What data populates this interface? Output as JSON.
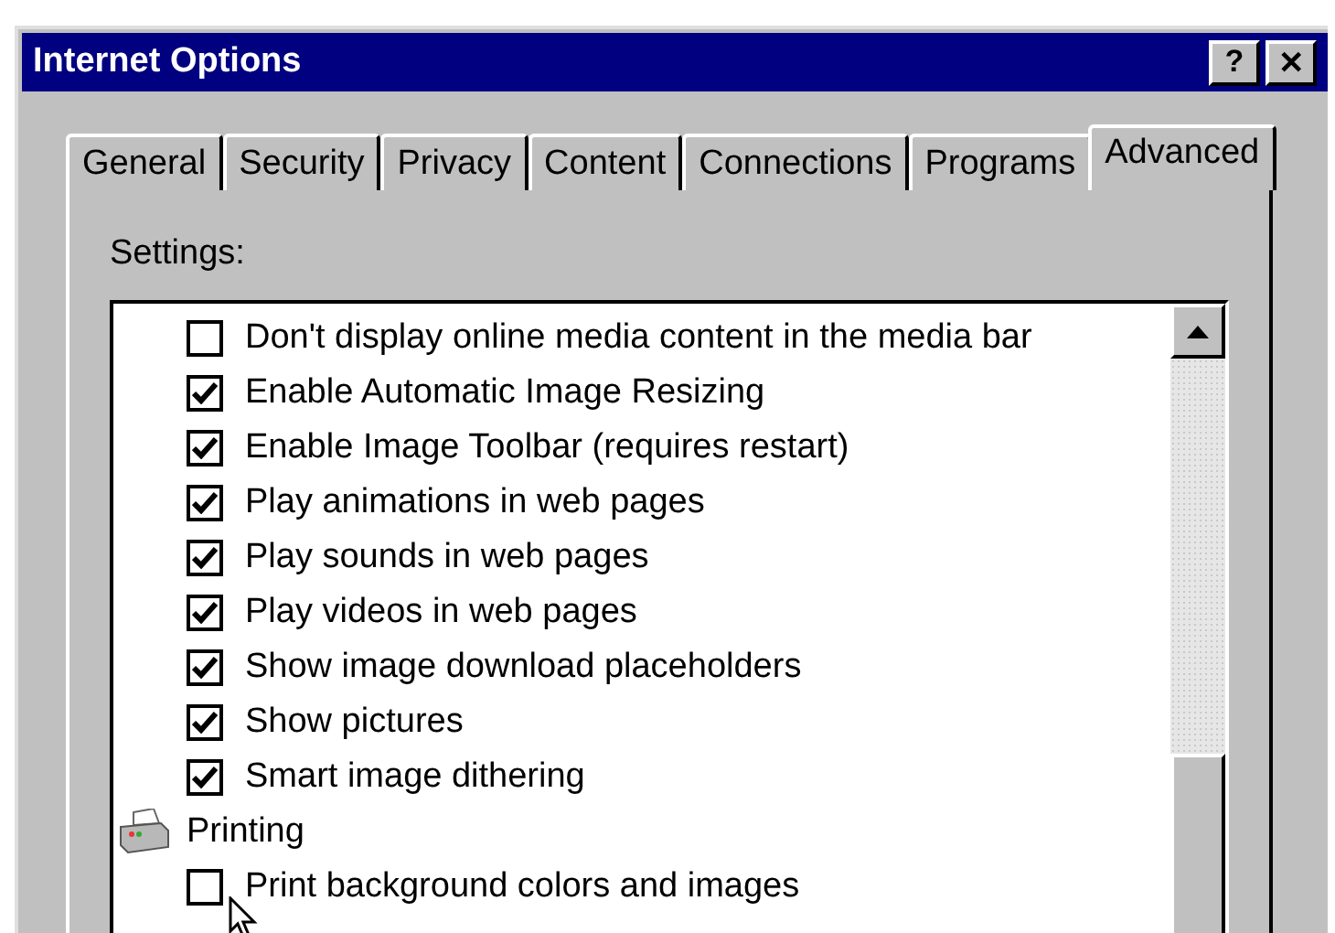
{
  "window": {
    "title": "Internet Options",
    "buttons": [
      "?",
      "✕"
    ]
  },
  "tabs": [
    {
      "label": "General",
      "selected": false
    },
    {
      "label": "Security",
      "selected": false
    },
    {
      "label": "Privacy",
      "selected": false
    },
    {
      "label": "Content",
      "selected": false
    },
    {
      "label": "Connections",
      "selected": false
    },
    {
      "label": "Programs",
      "selected": false
    },
    {
      "label": "Advanced",
      "selected": true
    }
  ],
  "settings": {
    "label": "Settings:",
    "items": [
      {
        "kind": "checkbox",
        "label": "Don't display online media content in the media bar",
        "checked": false
      },
      {
        "kind": "checkbox",
        "label": "Enable Automatic Image Resizing",
        "checked": true
      },
      {
        "kind": "checkbox",
        "label": "Enable Image Toolbar (requires restart)",
        "checked": true
      },
      {
        "kind": "checkbox",
        "label": "Play animations in web pages",
        "checked": true
      },
      {
        "kind": "checkbox",
        "label": "Play sounds in web pages",
        "checked": true
      },
      {
        "kind": "checkbox",
        "label": "Play videos in web pages",
        "checked": true
      },
      {
        "kind": "checkbox",
        "label": "Show image download placeholders",
        "checked": true
      },
      {
        "kind": "checkbox",
        "label": "Show pictures",
        "checked": true
      },
      {
        "kind": "checkbox",
        "label": "Smart image dithering",
        "checked": true
      },
      {
        "kind": "group",
        "label": "Printing"
      },
      {
        "kind": "checkbox",
        "label": "Print background colors and images",
        "checked": false
      }
    ]
  }
}
